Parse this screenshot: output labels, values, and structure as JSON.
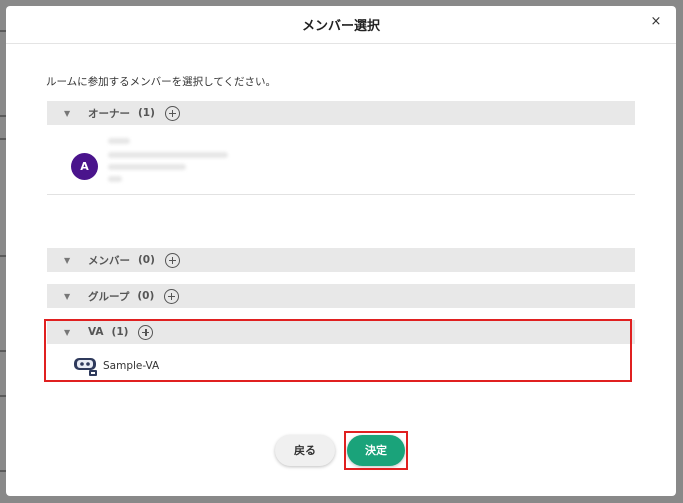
{
  "dialog": {
    "title": "メンバー選択",
    "close_glyph": "×",
    "instruction": "ルームに参加するメンバーを選択してください。"
  },
  "sections": [
    {
      "label": "オーナー",
      "count": "(1)",
      "expanded": true
    },
    {
      "label": "メンバー",
      "count": "(0)",
      "expanded": false
    },
    {
      "label": "グループ",
      "count": "(0)",
      "expanded": false
    },
    {
      "label": "VA",
      "count": "(1)",
      "expanded": true
    }
  ],
  "owner": {
    "avatar_initial": "A",
    "avatar_color": "#4a148c"
  },
  "va": {
    "name": "Sample-VA",
    "icon": "robot-icon"
  },
  "buttons": {
    "back": "戻る",
    "confirm": "決定"
  },
  "colors": {
    "confirm": "#1aa37a",
    "highlight": "#e02020",
    "section_bar": "#e8e8e8"
  }
}
